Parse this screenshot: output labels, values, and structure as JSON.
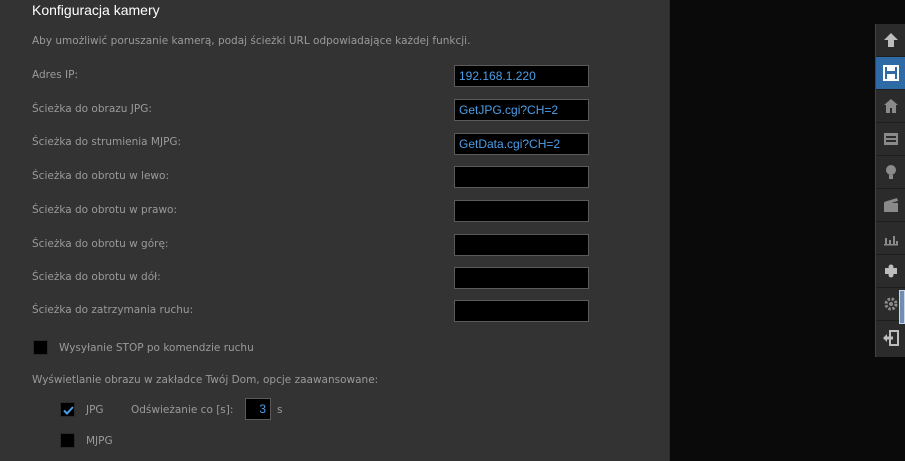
{
  "panel": {
    "title": "Konfiguracja kamery",
    "intro": "Aby umożliwić poruszanie kamerą, podaj ścieżki URL odpowiadające każdej funkcji.",
    "rows": [
      {
        "label": "Adres IP:",
        "value": "192.168.1.220"
      },
      {
        "label": "Ścieżka do obrazu JPG:",
        "value": "GetJPG.cgi?CH=2"
      },
      {
        "label": "Ścieżka do strumienia MJPG:",
        "value": "GetData.cgi?CH=2"
      },
      {
        "label": "Ścieżka do obrotu w lewo:",
        "value": ""
      },
      {
        "label": "Ścieżka do obrotu w prawo:",
        "value": ""
      },
      {
        "label": "Ścieżka do obrotu w górę:",
        "value": ""
      },
      {
        "label": "Ścieżka do obrotu w dół:",
        "value": ""
      },
      {
        "label": "Ścieżka do zatrzymania ruchu:",
        "value": ""
      }
    ],
    "stop_checkbox": {
      "label": "Wysyłanie STOP po komendzie ruchu",
      "checked": false
    },
    "display_heading": "Wyświetlanie obrazu w zakładce Twój Dom, opcje zaawansowane:",
    "jpg": {
      "label": "JPG",
      "checked": true,
      "refresh_label": "Odświeżanie co [s]:",
      "refresh_value": "3",
      "unit": "s"
    },
    "mjpg": {
      "label": "MJPG",
      "checked": false
    }
  },
  "toolbar": {
    "items": [
      {
        "icon": "arrow-up-icon"
      },
      {
        "icon": "save-icon",
        "active": true
      },
      {
        "icon": "home-icon"
      },
      {
        "icon": "control-panel-icon"
      },
      {
        "icon": "lightbulb-icon"
      },
      {
        "icon": "clapperboard-icon"
      },
      {
        "icon": "chart-icon"
      },
      {
        "icon": "puzzle-icon"
      },
      {
        "icon": "settings-icon"
      },
      {
        "icon": "logout-icon"
      }
    ]
  },
  "colors": {
    "accent": "#2d6aa6",
    "field_text": "#4d9fe8",
    "panel_bg": "#333333"
  }
}
